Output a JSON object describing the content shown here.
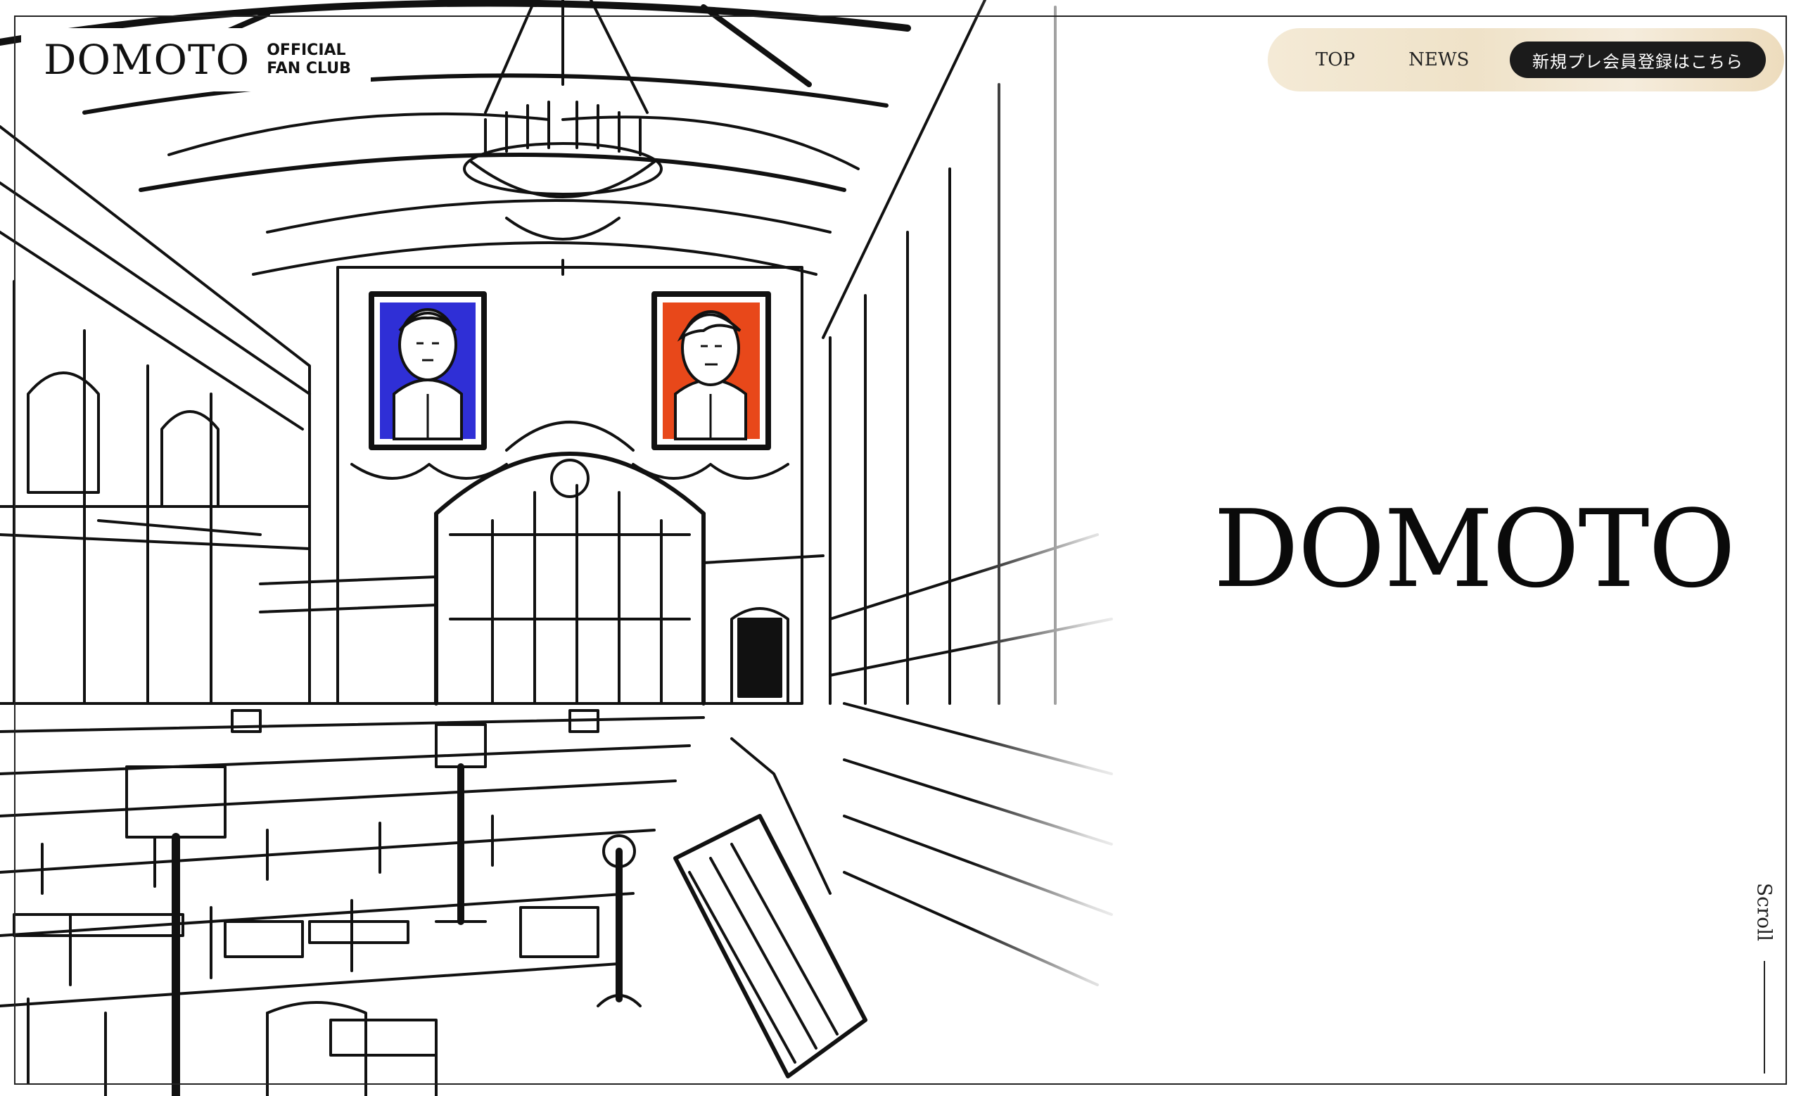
{
  "logo": {
    "wordmark": "DOMOTO",
    "sub_line1": "OFFICIAL",
    "sub_line2": "FAN CLUB"
  },
  "nav": {
    "items": [
      {
        "label": "TOP"
      },
      {
        "label": "NEWS"
      }
    ],
    "cta_label": "新規プレ会員登録はこちら"
  },
  "hero": {
    "title": "DOMOTO"
  },
  "scroll": {
    "label": "Scroll"
  },
  "colors": {
    "portrait_left": "#2f2fd6",
    "portrait_right": "#e8481a",
    "nav_bg": "#f1e5cd",
    "cta_bg": "#1b1b1b"
  }
}
